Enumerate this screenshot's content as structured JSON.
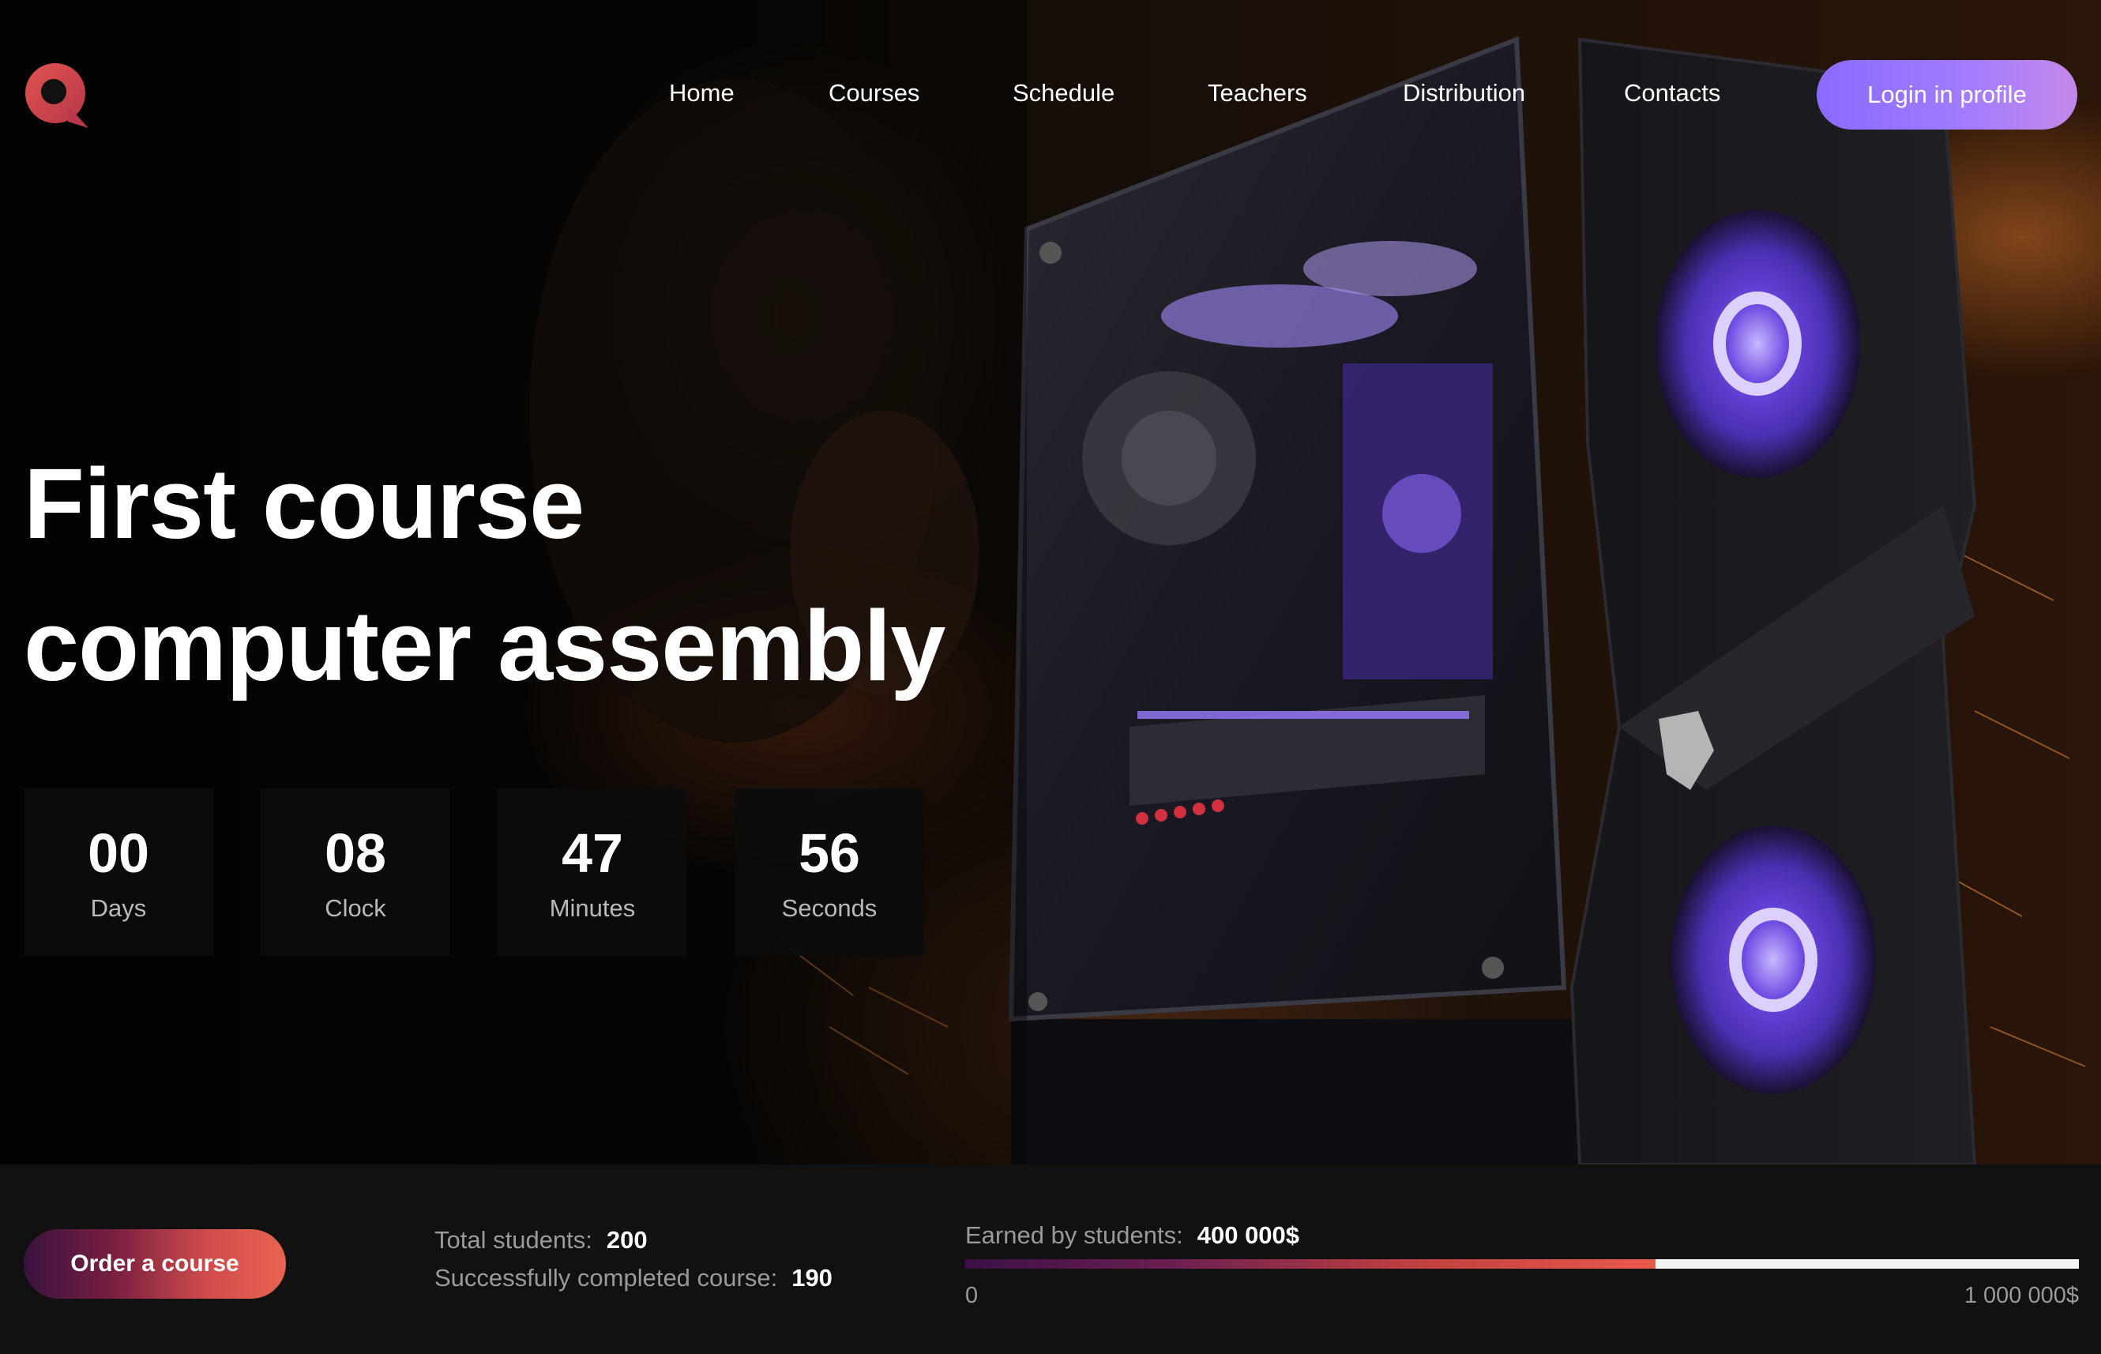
{
  "brand": {
    "logo_icon": "q-logo-icon",
    "accent": "#e0524e"
  },
  "nav": {
    "items": [
      "Home",
      "Courses",
      "Schedule",
      "Teachers",
      "Distribution",
      "Contacts"
    ],
    "login_label": "Login in profile"
  },
  "hero": {
    "title_line1": "First course",
    "title_line2": "computer assembly",
    "countdown": [
      {
        "value": "00",
        "label": "Days"
      },
      {
        "value": "08",
        "label": "Clock"
      },
      {
        "value": "47",
        "label": "Minutes"
      },
      {
        "value": "56",
        "label": "Seconds"
      }
    ]
  },
  "stats": {
    "order_label": "Order a course",
    "total_students_label": "Total students:",
    "total_students_value": "200",
    "completed_label": "Successfully completed course:",
    "completed_value": "190",
    "earned_label": "Earned by students:",
    "earned_value": "400 000$",
    "scale_min": "0",
    "scale_max": "1 000 000$",
    "progress_fraction": 0.62
  }
}
